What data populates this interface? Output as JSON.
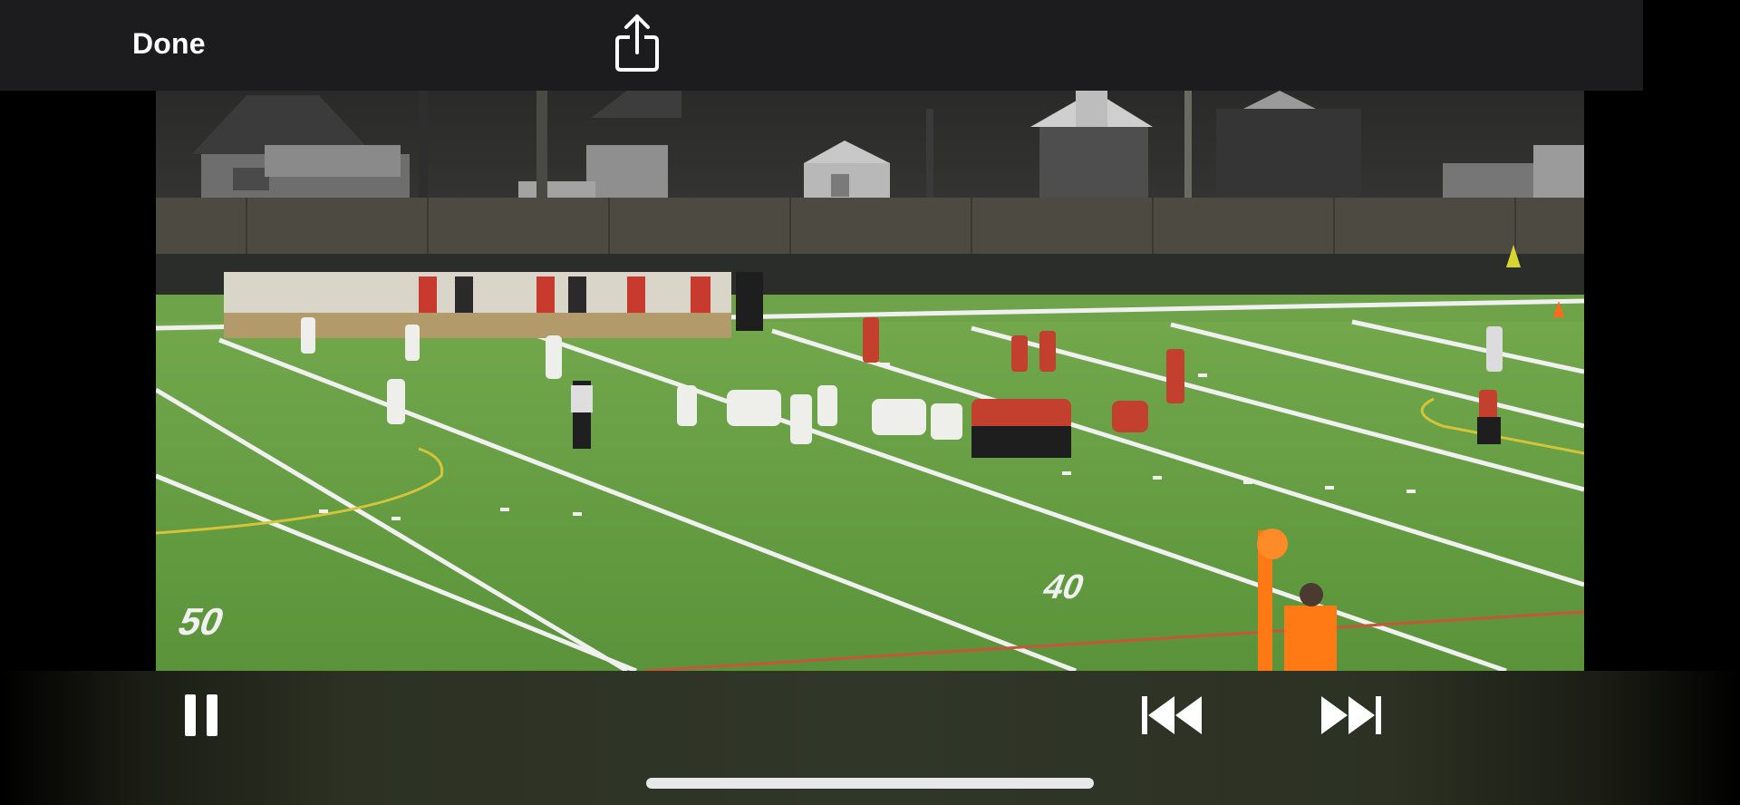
{
  "top_bar": {
    "done_label": "Done",
    "share_icon": "share-icon"
  },
  "video": {
    "field_numbers": {
      "fifty": "50",
      "forty": "40"
    }
  },
  "controls": {
    "pause_icon": "pause-icon",
    "skip_back_icon": "skip-back-icon",
    "skip_forward_icon": "skip-forward-icon"
  },
  "colors": {
    "top_bar": "#1c1c1e",
    "field_green": "#5f9a3d",
    "home_indicator": "#e8e8e8",
    "marker_orange": "#ff7a14"
  }
}
